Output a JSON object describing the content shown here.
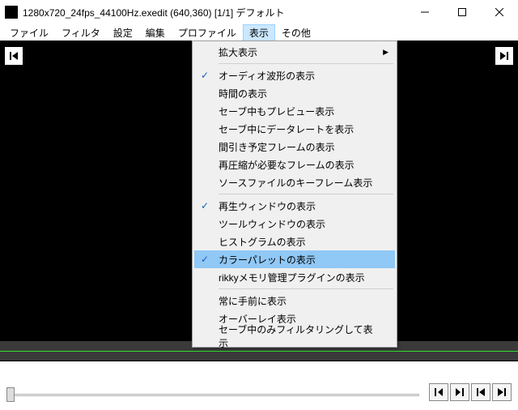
{
  "window": {
    "title": "1280x720_24fps_44100Hz.exedit (640,360)  [1/1]  デフォルト"
  },
  "menubar": {
    "items": [
      {
        "label": "ファイル"
      },
      {
        "label": "フィルタ"
      },
      {
        "label": "設定"
      },
      {
        "label": "編集"
      },
      {
        "label": "プロファイル"
      },
      {
        "label": "表示",
        "open": true
      },
      {
        "label": "その他"
      }
    ]
  },
  "dropdown": {
    "items": [
      {
        "label": "拡大表示",
        "submenu": true
      },
      {
        "sep": true
      },
      {
        "label": "オーディオ波形の表示",
        "checked": true
      },
      {
        "label": "時間の表示"
      },
      {
        "label": "セーブ中もプレビュー表示"
      },
      {
        "label": "セーブ中にデータレートを表示"
      },
      {
        "label": "間引き予定フレームの表示"
      },
      {
        "label": "再圧縮が必要なフレームの表示"
      },
      {
        "label": "ソースファイルのキーフレーム表示"
      },
      {
        "sep": true
      },
      {
        "label": "再生ウィンドウの表示",
        "checked": true
      },
      {
        "label": "ツールウィンドウの表示"
      },
      {
        "label": "ヒストグラムの表示"
      },
      {
        "label": "カラーパレットの表示",
        "checked": true,
        "highlight": true
      },
      {
        "label": "rikkyメモリ管理プラグインの表示"
      },
      {
        "sep": true
      },
      {
        "label": "常に手前に表示"
      },
      {
        "label": "オーバーレイ表示"
      },
      {
        "label": "セーブ中のみフィルタリングして表示"
      }
    ]
  }
}
